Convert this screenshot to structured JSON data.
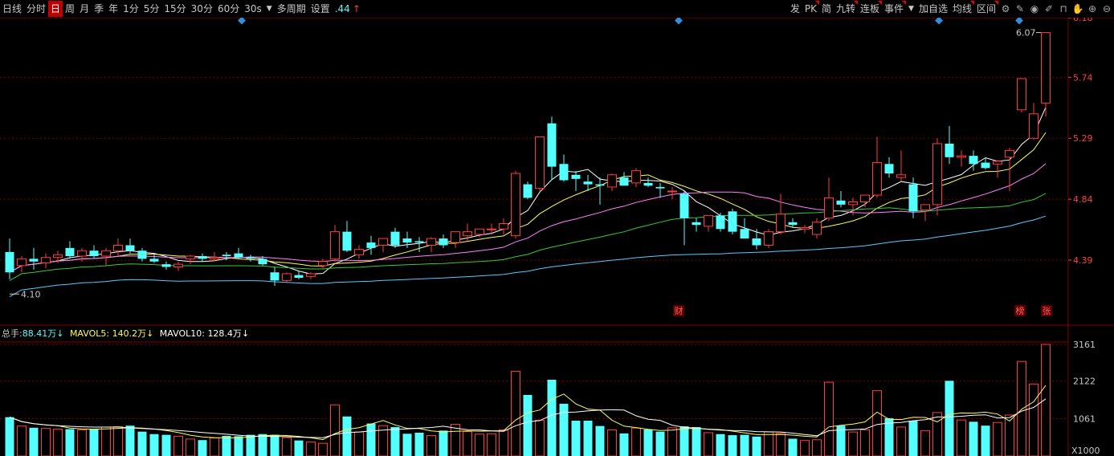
{
  "toolbar": {
    "items": [
      "日线",
      "分时",
      "日",
      "周",
      "月",
      "季",
      "年",
      "1分",
      "5分",
      "15分",
      "30分",
      "60分",
      "30s",
      "多周期",
      "设置",
      ".44"
    ],
    "active_index": 2,
    "right_items": [
      "发",
      "PK",
      "简",
      "九转",
      "连板",
      "事件",
      "加自选",
      "均线",
      "区间"
    ]
  },
  "price_panel": {
    "y_axis_ticks": [
      "6.18",
      "5.74",
      "5.29",
      "4.84",
      "4.39"
    ],
    "high_label": "6.07",
    "low_label": "4.10",
    "markers": [
      "财",
      "榜",
      "张"
    ]
  },
  "volume_panel": {
    "legend": {
      "total_label": "总手:",
      "total_value": "88.41万",
      "mavol5_label": "MAVOL5:",
      "mavol5_value": "140.2万",
      "mavol10_label": "MAVOL10:",
      "mavol10_value": "128.4万"
    },
    "y_axis_ticks": [
      "3161",
      "2122",
      "1061"
    ],
    "unit_label": "X1000"
  },
  "colors": {
    "up": "#ff3b3b",
    "down": "#54ffff",
    "ma5": "#ffffff",
    "ma10": "#ffff55",
    "ma20": "#ff80ff",
    "ma30": "#33cc33",
    "ma60": "#55ccff",
    "grid": "#800000"
  },
  "chart_data": {
    "type": "candlestick",
    "ylim": [
      4.1,
      6.18
    ],
    "volume_ylim": [
      0,
      3161
    ],
    "candles": [
      [
        4.45,
        4.55,
        4.25,
        4.3,
        1100
      ],
      [
        4.35,
        4.42,
        4.3,
        4.4,
        850
      ],
      [
        4.4,
        4.48,
        4.32,
        4.38,
        800
      ],
      [
        4.37,
        4.44,
        4.33,
        4.41,
        780
      ],
      [
        4.41,
        4.46,
        4.37,
        4.43,
        760
      ],
      [
        4.48,
        4.53,
        4.4,
        4.42,
        760
      ],
      [
        4.42,
        4.48,
        4.38,
        4.46,
        740
      ],
      [
        4.46,
        4.5,
        4.4,
        4.42,
        760
      ],
      [
        4.42,
        4.48,
        4.35,
        4.46,
        820
      ],
      [
        4.46,
        4.55,
        4.42,
        4.5,
        830
      ],
      [
        4.5,
        4.55,
        4.44,
        4.46,
        860
      ],
      [
        4.46,
        4.48,
        4.38,
        4.4,
        690
      ],
      [
        4.4,
        4.43,
        4.37,
        4.38,
        620
      ],
      [
        4.36,
        4.38,
        4.32,
        4.34,
        600
      ],
      [
        4.34,
        4.38,
        4.31,
        4.36,
        560
      ],
      [
        4.4,
        4.43,
        4.36,
        4.42,
        480
      ],
      [
        4.42,
        4.44,
        4.38,
        4.4,
        450
      ],
      [
        4.4,
        4.45,
        4.38,
        4.41,
        510
      ],
      [
        4.43,
        4.45,
        4.39,
        4.42,
        570
      ],
      [
        4.44,
        4.48,
        4.4,
        4.41,
        560
      ],
      [
        4.41,
        4.43,
        4.38,
        4.4,
        600
      ],
      [
        4.4,
        4.42,
        4.35,
        4.36,
        620
      ],
      [
        4.3,
        4.34,
        4.2,
        4.24,
        600
      ],
      [
        4.24,
        4.3,
        4.22,
        4.29,
        520
      ],
      [
        4.28,
        4.31,
        4.25,
        4.26,
        440
      ],
      [
        4.27,
        4.3,
        4.25,
        4.29,
        400
      ],
      [
        4.35,
        4.4,
        4.33,
        4.38,
        360
      ],
      [
        4.4,
        4.65,
        4.38,
        4.6,
        1450
      ],
      [
        4.6,
        4.68,
        4.45,
        4.46,
        1120
      ],
      [
        4.43,
        4.5,
        4.4,
        4.47,
        680
      ],
      [
        4.52,
        4.57,
        4.43,
        4.48,
        920
      ],
      [
        4.5,
        4.55,
        4.45,
        4.55,
        860
      ],
      [
        4.6,
        4.63,
        4.48,
        4.5,
        820
      ],
      [
        4.55,
        4.6,
        4.48,
        4.52,
        630
      ],
      [
        4.53,
        4.56,
        4.45,
        4.52,
        660
      ],
      [
        4.5,
        4.56,
        4.45,
        4.55,
        580
      ],
      [
        4.55,
        4.58,
        4.48,
        4.5,
        720
      ],
      [
        4.52,
        4.6,
        4.48,
        4.6,
        900
      ],
      [
        4.57,
        4.66,
        4.53,
        4.6,
        690
      ],
      [
        4.58,
        4.62,
        4.56,
        4.62,
        620
      ],
      [
        4.62,
        4.66,
        4.58,
        4.62,
        630
      ],
      [
        4.62,
        4.7,
        4.58,
        4.66,
        740
      ],
      [
        4.57,
        5.05,
        4.55,
        5.03,
        2400
      ],
      [
        4.95,
        4.97,
        4.84,
        4.85,
        1730
      ],
      [
        4.92,
        5.3,
        4.9,
        5.3,
        1010
      ],
      [
        5.4,
        5.45,
        4.98,
        5.08,
        2160
      ],
      [
        5.1,
        5.17,
        4.97,
        4.98,
        1480
      ],
      [
        5.02,
        5.05,
        4.9,
        4.99,
        1000
      ],
      [
        4.97,
        5.02,
        4.9,
        4.95,
        1000
      ],
      [
        4.95,
        5.0,
        4.8,
        4.94,
        850
      ],
      [
        4.93,
        5.03,
        4.9,
        5.02,
        740
      ],
      [
        5.0,
        5.04,
        4.95,
        4.94,
        640
      ],
      [
        4.96,
        5.07,
        4.93,
        5.05,
        790
      ],
      [
        4.96,
        5.0,
        4.93,
        4.94,
        750
      ],
      [
        4.93,
        4.96,
        4.85,
        4.92,
        690
      ],
      [
        4.9,
        4.93,
        4.84,
        4.9,
        800
      ],
      [
        4.88,
        4.9,
        4.5,
        4.7,
        840
      ],
      [
        4.67,
        4.7,
        4.6,
        4.65,
        820
      ],
      [
        4.64,
        4.72,
        4.6,
        4.72,
        660
      ],
      [
        4.72,
        4.74,
        4.6,
        4.62,
        620
      ],
      [
        4.75,
        4.77,
        4.58,
        4.6,
        590
      ],
      [
        4.62,
        4.7,
        4.55,
        4.55,
        600
      ],
      [
        4.55,
        4.62,
        4.47,
        4.5,
        550
      ],
      [
        4.5,
        4.62,
        4.48,
        4.6,
        680
      ],
      [
        4.6,
        4.88,
        4.58,
        4.73,
        640
      ],
      [
        4.67,
        4.7,
        4.63,
        4.65,
        490
      ],
      [
        4.62,
        4.65,
        4.59,
        4.63,
        440
      ],
      [
        4.58,
        4.7,
        4.55,
        4.67,
        460
      ],
      [
        4.7,
        5.0,
        4.68,
        4.85,
        2090
      ],
      [
        4.83,
        4.9,
        4.78,
        4.8,
        860
      ],
      [
        4.8,
        4.85,
        4.72,
        4.82,
        680
      ],
      [
        4.82,
        4.87,
        4.78,
        4.87,
        740
      ],
      [
        4.87,
        5.3,
        4.85,
        5.11,
        1850
      ],
      [
        5.1,
        5.15,
        5.0,
        5.03,
        1070
      ],
      [
        5.0,
        5.2,
        4.97,
        5.02,
        820
      ],
      [
        4.95,
        5.0,
        4.7,
        4.75,
        1000
      ],
      [
        4.76,
        4.8,
        4.68,
        4.8,
        720
      ],
      [
        4.8,
        5.29,
        4.72,
        5.25,
        1230
      ],
      [
        5.25,
        5.38,
        5.1,
        5.15,
        2130
      ],
      [
        5.15,
        5.2,
        5.08,
        5.16,
        1020
      ],
      [
        5.16,
        5.2,
        5.05,
        5.1,
        970
      ],
      [
        5.11,
        5.15,
        5.06,
        5.07,
        860
      ],
      [
        5.1,
        5.13,
        5.0,
        5.12,
        950
      ],
      [
        5.15,
        5.22,
        4.9,
        5.2,
        1160
      ],
      [
        5.5,
        5.7,
        5.48,
        5.73,
        2680
      ],
      [
        5.29,
        5.55,
        5.28,
        5.47,
        2040
      ],
      [
        5.55,
        6.07,
        5.45,
        6.07,
        3161
      ]
    ]
  }
}
